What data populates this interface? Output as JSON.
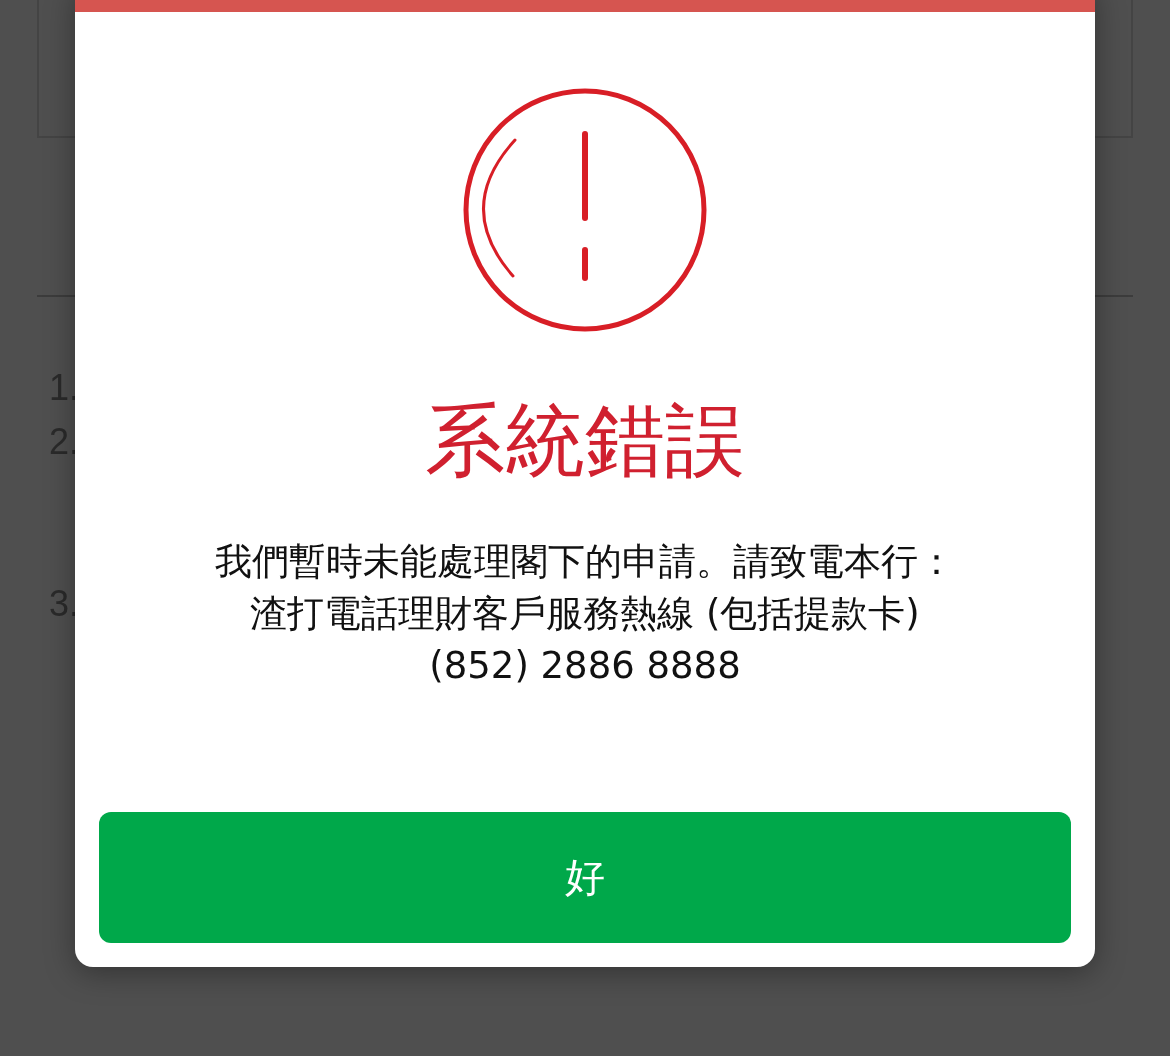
{
  "background": {
    "list_markers": [
      "1.",
      "2.",
      "3."
    ]
  },
  "dialog": {
    "title": "系統錯誤",
    "message_lines": [
      "我們暫時未能處理閣下的申請。請致電本行：",
      "渣打電話理財客戶服務熱線 (包括提款卡)",
      "(852) 2886 8888"
    ],
    "button": {
      "label": "好"
    }
  }
}
